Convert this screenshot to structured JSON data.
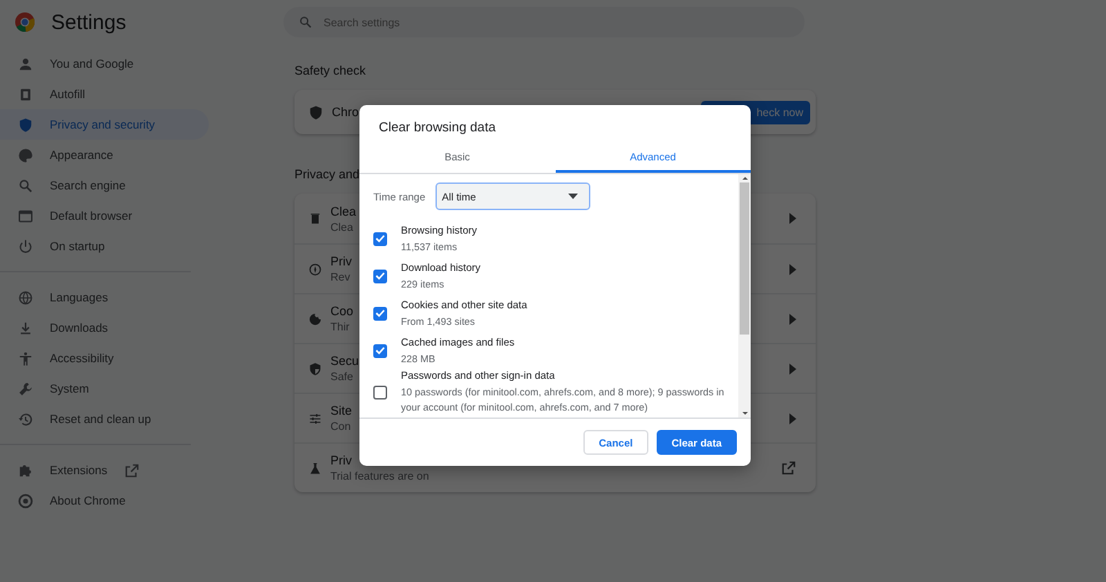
{
  "header": {
    "title": "Settings",
    "search": {
      "placeholder": "Search settings"
    }
  },
  "sidebar": {
    "groups": [
      [
        {
          "label": "You and Google",
          "selected": false
        },
        {
          "label": "Autofill",
          "selected": false
        },
        {
          "label": "Privacy and security",
          "selected": true
        },
        {
          "label": "Appearance",
          "selected": false
        },
        {
          "label": "Search engine",
          "selected": false
        },
        {
          "label": "Default browser",
          "selected": false
        },
        {
          "label": "On startup",
          "selected": false
        }
      ],
      [
        {
          "label": "Languages",
          "selected": false
        },
        {
          "label": "Downloads",
          "selected": false
        },
        {
          "label": "Accessibility",
          "selected": false
        },
        {
          "label": "System",
          "selected": false
        },
        {
          "label": "Reset and clean up",
          "selected": false
        }
      ],
      [
        {
          "label": "Extensions",
          "selected": false,
          "kind": "external"
        },
        {
          "label": "About Chrome",
          "selected": false
        }
      ]
    ]
  },
  "safety_check": {
    "heading": "Safety check",
    "text": "Chro",
    "button": "heck now"
  },
  "privacy": {
    "heading": "Privacy and",
    "rows": [
      {
        "title": "Clea",
        "subtitle": "Clea",
        "kind": "arrow"
      },
      {
        "title": "Priv",
        "subtitle": "Rev",
        "kind": "arrow"
      },
      {
        "title": "Coo",
        "subtitle": "Thir",
        "kind": "arrow"
      },
      {
        "title": "Secu",
        "subtitle": "Safe",
        "kind": "arrow"
      },
      {
        "title": "Site",
        "subtitle": "Con",
        "kind": "arrow"
      },
      {
        "title": "Priv",
        "subtitle": "Trial features are on",
        "kind": "external"
      }
    ]
  },
  "dialog": {
    "title": "Clear browsing data",
    "tabs": [
      {
        "label": "Basic",
        "selected": false
      },
      {
        "label": "Advanced",
        "selected": true
      }
    ],
    "time_range": {
      "label": "Time range",
      "value": "All time"
    },
    "options": [
      {
        "label": "Browsing history",
        "detail": "11,537 items",
        "checked": true
      },
      {
        "label": "Download history",
        "detail": "229 items",
        "checked": true
      },
      {
        "label": "Cookies and other site data",
        "detail": "From 1,493 sites",
        "checked": true
      },
      {
        "label": "Cached images and files",
        "detail": "228 MB",
        "checked": true
      },
      {
        "label": "Passwords and other sign-in data",
        "detail": "10 passwords (for minitool.com, ahrefs.com, and 8 more); 9 passwords in your account (for minitool.com, ahrefs.com, and 7 more)",
        "checked": false
      }
    ],
    "buttons": [
      {
        "label": "Cancel",
        "kind": "secondary"
      },
      {
        "label": "Clear data",
        "kind": "primary"
      }
    ]
  }
}
